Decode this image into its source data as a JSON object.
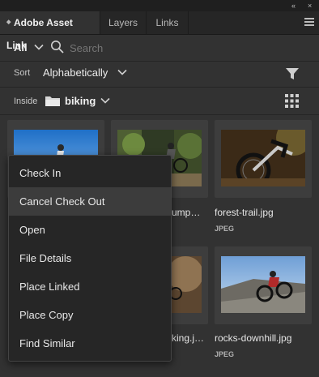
{
  "window": {
    "collapse_glyph": "«",
    "close_glyph": "×"
  },
  "tabs": [
    {
      "label": "Adobe Asset Link",
      "active": true
    },
    {
      "label": "Layers",
      "active": false
    },
    {
      "label": "Links",
      "active": false
    }
  ],
  "filter": {
    "scope_value": "All",
    "search_placeholder": "Search"
  },
  "sort": {
    "label": "Sort",
    "value": "Alphabetically"
  },
  "location": {
    "label": "Inside",
    "folder": "biking"
  },
  "assets": [
    {
      "name": "",
      "type": ""
    },
    {
      "name": "…ump…",
      "type": ""
    },
    {
      "name": "forest-trail.jpg",
      "type": "JPEG"
    },
    {
      "name": "",
      "type": ""
    },
    {
      "name": "…king.j…",
      "type": ""
    },
    {
      "name": "rocks-downhill.jpg",
      "type": "JPEG"
    }
  ],
  "context_menu": {
    "items": [
      "Check In",
      "Cancel Check Out",
      "Open",
      "File Details",
      "Place Linked",
      "Place Copy",
      "Find Similar"
    ],
    "highlighted_index": 1
  },
  "colors": {
    "panel_bg": "#323232",
    "tab_bar_bg": "#262626",
    "menu_bg": "#262626",
    "menu_highlight": "#3c3c3c"
  }
}
